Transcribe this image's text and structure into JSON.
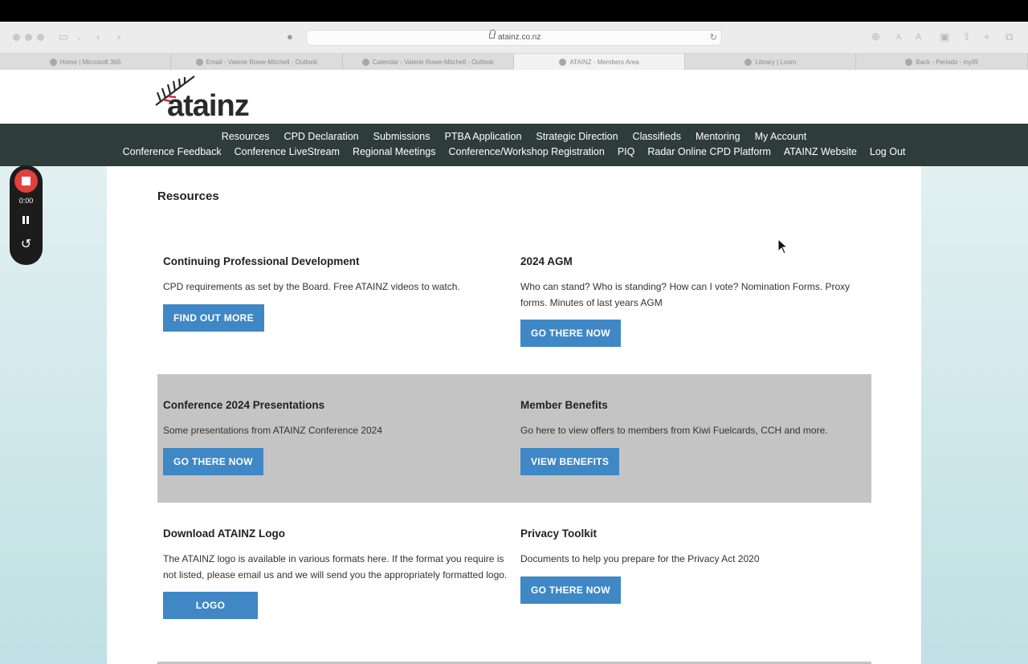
{
  "browser": {
    "url": "atainz.co.nz",
    "tabs": [
      {
        "label": "Home | Microsoft 365",
        "active": false
      },
      {
        "label": "Email - Valerie Rowe-Mitchell - Outlook",
        "active": false
      },
      {
        "label": "Calendar - Valerie Rowe-Mitchell - Outlook",
        "active": false
      },
      {
        "label": "ATAINZ - Members Area",
        "active": true
      },
      {
        "label": "Library | Loom",
        "active": false
      },
      {
        "label": "Back - Periods - myIR",
        "active": false
      }
    ]
  },
  "site": {
    "logo_text": "atainz",
    "nav_row1": [
      "Resources",
      "CPD Declaration",
      "Submissions",
      "PTBA Application",
      "Strategic Direction",
      "Classifieds",
      "Mentoring",
      "My Account"
    ],
    "nav_row2": [
      "Conference Feedback",
      "Conference LiveStream",
      "Regional Meetings",
      "Conference/Workshop Registration",
      "PIQ",
      "Radar Online CPD Platform",
      "ATAINZ Website",
      "Log Out"
    ]
  },
  "page": {
    "title": "Resources",
    "cards": [
      {
        "title": "Continuing Professional Development",
        "text": "CPD requirements as set by the Board. Free ATAINZ videos to watch.",
        "button": "FIND OUT MORE"
      },
      {
        "title": "2024 AGM",
        "text": "Who can stand? Who is standing? How can I vote? Nomination Forms. Proxy forms. Minutes of last years AGM",
        "button": "GO THERE NOW"
      },
      {
        "title": "Conference 2024 Presentations",
        "text": "Some presentations from ATAINZ Conference 2024",
        "button": "GO THERE NOW"
      },
      {
        "title": "Member Benefits",
        "text": "Go here to view offers to members from Kiwi Fuelcards, CCH and more.",
        "button": "VIEW BENEFITS"
      },
      {
        "title": "Download ATAINZ Logo",
        "text": "The ATAINZ logo is available in various formats here. If the format you require is not listed, please email us and we will send you the appropriately formatted logo.",
        "button": "LOGO"
      },
      {
        "title": "Privacy Toolkit",
        "text": "Documents to help you prepare for the Privacy Act 2020",
        "button": "GO THERE NOW"
      }
    ]
  },
  "recorder": {
    "time": "0:00"
  },
  "colors": {
    "nav_bg": "#2e3d3a",
    "button": "#3f88c5",
    "section_gray": "#c4c4c4",
    "record_red": "#e0413b"
  }
}
